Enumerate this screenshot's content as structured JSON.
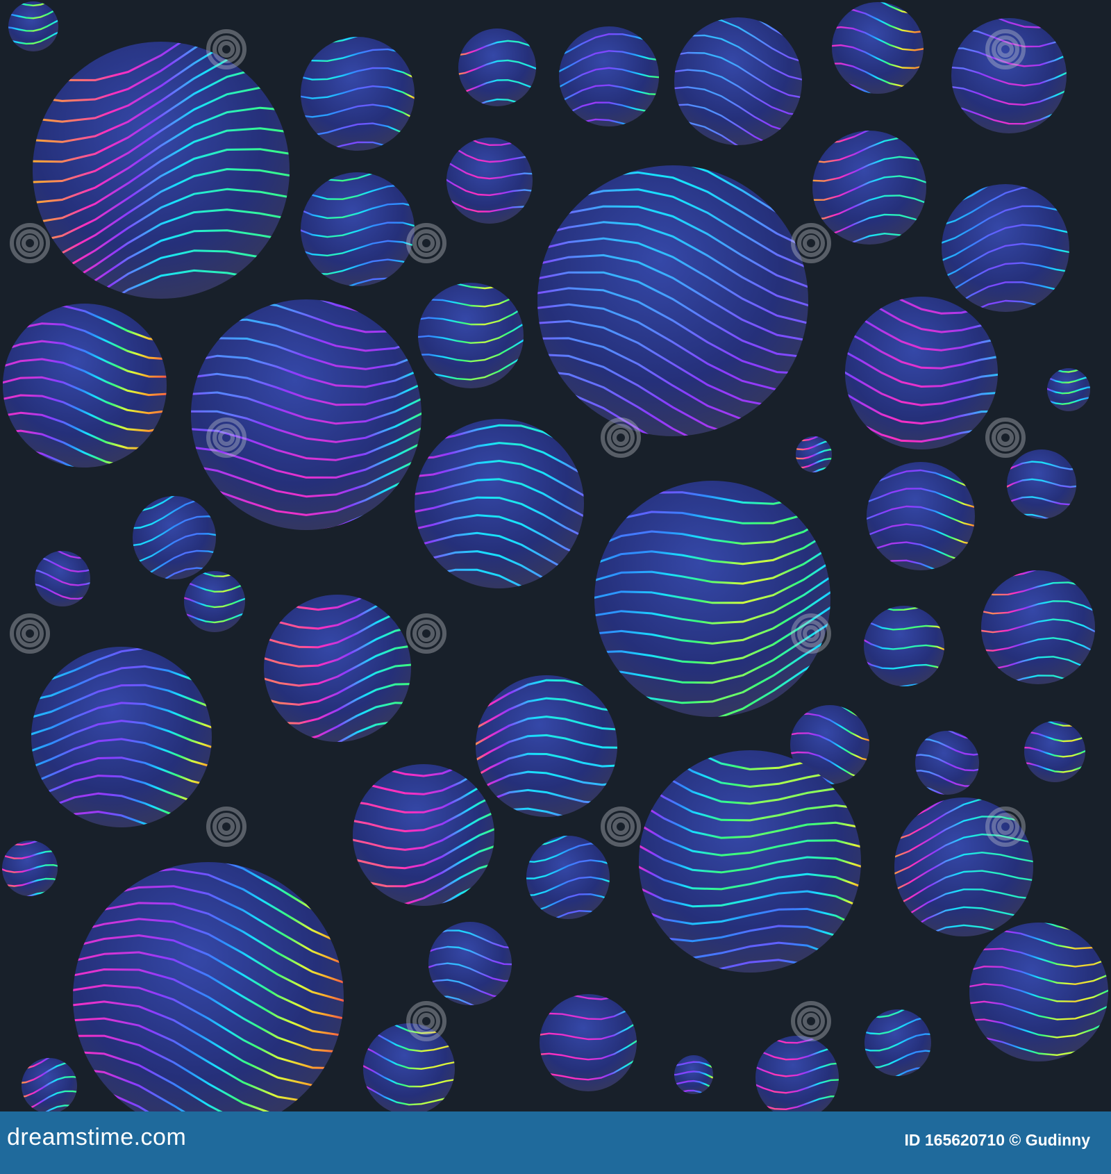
{
  "image": {
    "background_color": "#18202a",
    "footer_color": "#1f6a9c",
    "pattern_description_colors": [
      "#ff2fbf",
      "#8a3cff",
      "#2f8cff",
      "#18e0ff",
      "#3cff7a",
      "#d8ff3c",
      "#ffb02a",
      "#ff4a4a"
    ],
    "watermark_text": "dreamstime",
    "watermark_icon": "spiral-icon"
  },
  "footer": {
    "brand": "dreamstime.com",
    "id_label": "ID",
    "id_value": "165620710",
    "copyright_symbol": "©",
    "author": "Gudinny"
  }
}
